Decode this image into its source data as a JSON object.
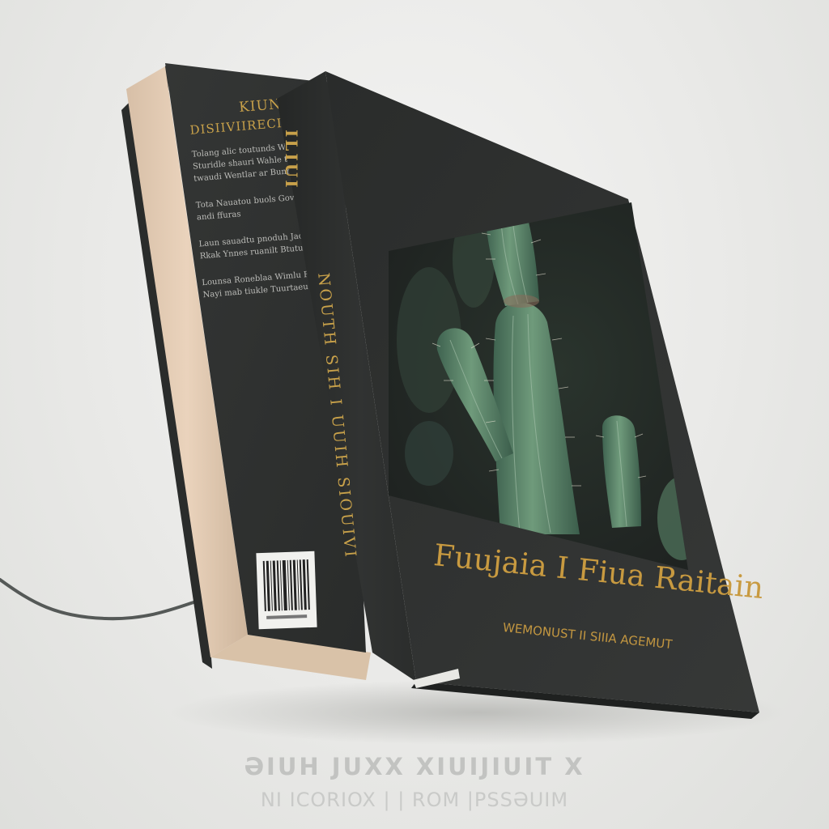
{
  "scene": {
    "subject": "book-mockup",
    "colors": {
      "background": "#ececea",
      "cover": "#2f3130",
      "gold_text": "#c89a40",
      "pages": "#e6cfb8",
      "cactus": "#4f7a5d"
    }
  },
  "back_cover": {
    "title": "KIUNIT",
    "subtitle": "DISIIVIIRECIOE",
    "blurb": [
      "Tolang alic toutunds Woldu  Sturidle shauri  Wahle thaie twaudi  Wentlar ar Bunnits",
      "Tota Nauatou buols Govtedw andi ffuras",
      "Laun sauadtu pnoduh Jadlons Rkak Ynnes ruanilt Btutui",
      "Lounsa Roneblaa Wimlu  Ftut Nayi mab tiukle  Tuurtaeu Rohes"
    ],
    "barcode_icon": "barcode-icon"
  },
  "spine": {
    "top_text": "ILIUI",
    "text": "NOUTH SIH  I  UUIH  SIOUIVI"
  },
  "front_cover": {
    "title": "Fuujaia I Fiua Raitain",
    "author": "WEMONUST  II  SIIIA  AGEMUT",
    "image_icon": "cactus-photo"
  },
  "caption": {
    "line1": "ƏIUH  JUXX  XIUIJIUIT X",
    "line2": "NI  ICORIOX  | | ROM  |PSSƏUIM"
  }
}
